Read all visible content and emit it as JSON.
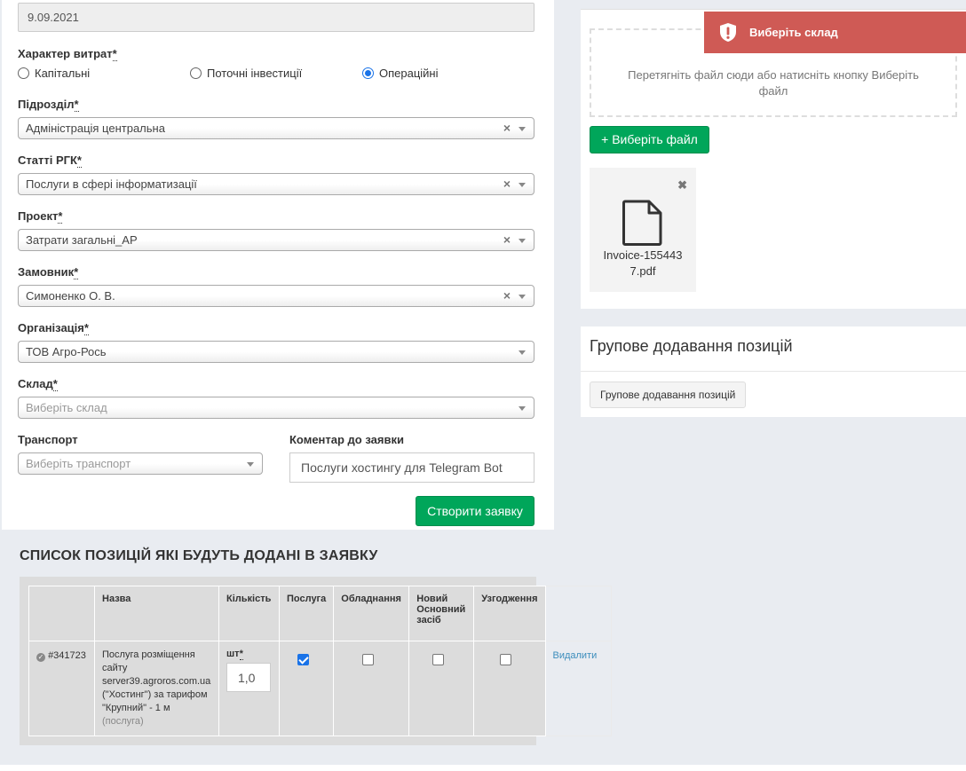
{
  "form": {
    "date_value": "9.09.2021",
    "cost_type_label": "Характер витрат",
    "cost_type_options": [
      "Капітальні",
      "Поточні інвестиції",
      "Операційні"
    ],
    "cost_type_selected": "Операційні",
    "department_label": "Підрозділ",
    "department_value": "Адміністрація центральна",
    "rgk_label": "Статті РГК",
    "rgk_value": "Послуги в сфері інформатизації",
    "project_label": "Проект",
    "project_value": "Затрати загальні_АР",
    "customer_label": "Замовник",
    "customer_value": "Симоненко О. В.",
    "organization_label": "Організація",
    "organization_value": "ТОВ Агро-Рось",
    "warehouse_label": "Склад",
    "warehouse_placeholder": "Виберіть склад",
    "transport_label": "Транспорт",
    "transport_placeholder": "Виберіть транспорт",
    "comment_label": "Коментар до заявки",
    "comment_value": "Послуги хостингу для Telegram Bot",
    "required_mark": "*",
    "submit_label": "Створити заявку"
  },
  "positions": {
    "title": "СПИСОК ПОЗИЦІЙ ЯКІ БУДУТЬ ДОДАНІ В ЗАЯВКУ",
    "headers": [
      "",
      "Назва",
      "Кількість",
      "Послуга",
      "Обладнання",
      "Новий Основний засіб",
      "Узгодження"
    ],
    "rows": [
      {
        "id": "#341723",
        "name": "Послуга розміщення сайту server39.agroros.com.ua (\"Хостинг\") за тарифом \"Крупний\" - 1 м",
        "name_note": "(послуга)",
        "unit": "шт",
        "quantity": "1,0",
        "service": true,
        "equipment": false,
        "new_fixed_asset": false,
        "approval": false,
        "delete_label": "Видалити"
      }
    ]
  },
  "upload": {
    "dropzone_text": "Перетягніть файл сюди або натисніть кнопку Виберіть файл",
    "choose_button": "+ Виберіть файл",
    "file_name": "Invoice-1554437.pdf"
  },
  "toast": {
    "message": "Виберіть склад"
  },
  "group_add": {
    "title": "Групове додавання позицій",
    "button": "Групове додавання позицій"
  },
  "colors": {
    "primary_green": "#00a65a",
    "toast_red": "#cf5a55",
    "link_blue": "#3c8dbc"
  }
}
